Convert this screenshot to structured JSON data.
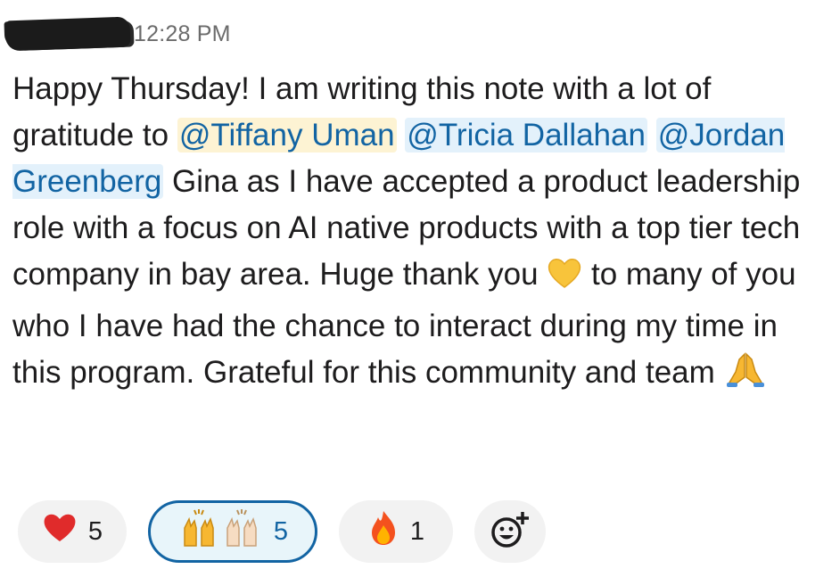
{
  "message": {
    "author_redacted": true,
    "timestamp": "12:28 PM",
    "segments": {
      "s1": "Happy Thursday! I am writing this note with a lot of gratitude to ",
      "m1": "@Tiffany Uman",
      "m2": "@Tricia Dallahan",
      "m3": "@Jordan Greenberg",
      "s2": " Gina as I have accepted a product leadership role with a focus on AI native products with a top tier tech company in bay area. Huge thank you ",
      "s3": " to many of you who I have had the chance to interact during my time in this program. Grateful for this community and team "
    },
    "inline_emojis": [
      "yellow-heart",
      "folded-hands"
    ]
  },
  "reactions": [
    {
      "emoji": "red-heart",
      "count": "5",
      "active": false
    },
    {
      "emoji": "raised-hands",
      "count": "5",
      "active": true
    },
    {
      "emoji": "fire",
      "count": "1",
      "active": false
    }
  ],
  "add_reaction": {
    "icon": "add-reaction-icon"
  },
  "colors": {
    "mention_text": "#1264a3",
    "mention_bg": "#e3f1fb",
    "self_mention_bg": "#fdf3d3",
    "active_reaction_border": "#1264a3",
    "active_reaction_bg": "#e8f5fa",
    "reaction_bg": "#f2f2f2",
    "timestamp": "#6b6b6b",
    "text": "#1d1c1d"
  }
}
